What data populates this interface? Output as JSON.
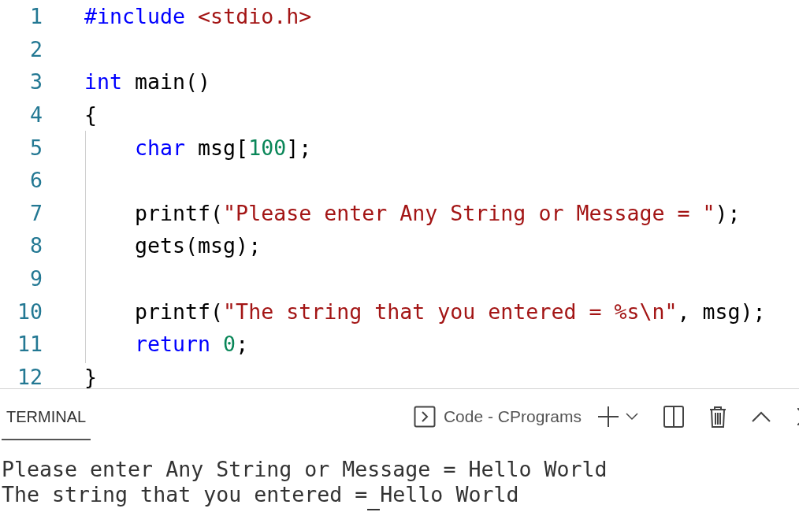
{
  "editor": {
    "lines": [
      {
        "number": "1",
        "indented": false,
        "tokens": [
          {
            "kind": "keyword",
            "text": "#include"
          },
          {
            "kind": "string",
            "text": " <stdio.h>"
          }
        ]
      },
      {
        "number": "2"
      },
      {
        "number": "3",
        "indented": false,
        "tokens": [
          {
            "kind": "keyword",
            "text": "int"
          },
          {
            "kind": "plain",
            "text": " main()"
          }
        ]
      },
      {
        "number": "4",
        "indented": false,
        "tokens": [
          {
            "kind": "plain",
            "text": "{"
          }
        ]
      },
      {
        "number": "5",
        "indented": true,
        "tokens": [
          {
            "kind": "keyword",
            "text": "char"
          },
          {
            "kind": "plain",
            "text": " msg["
          },
          {
            "kind": "number",
            "text": "100"
          },
          {
            "kind": "plain",
            "text": "];"
          }
        ]
      },
      {
        "number": "6"
      },
      {
        "number": "7",
        "indented": true,
        "tokens": [
          {
            "kind": "plain",
            "text": "printf("
          },
          {
            "kind": "string",
            "text": "\"Please enter Any String or Message = \""
          },
          {
            "kind": "plain",
            "text": ");"
          }
        ]
      },
      {
        "number": "8",
        "indented": true,
        "tokens": [
          {
            "kind": "plain",
            "text": "gets(msg);"
          }
        ]
      },
      {
        "number": "9"
      },
      {
        "number": "10",
        "indented": true,
        "tokens": [
          {
            "kind": "plain",
            "text": "printf("
          },
          {
            "kind": "string",
            "text": "\"The string that you entered = %s\\n\""
          },
          {
            "kind": "plain",
            "text": ", msg);"
          }
        ]
      },
      {
        "number": "11",
        "indented": true,
        "tokens": [
          {
            "kind": "keyword",
            "text": "return"
          },
          {
            "kind": "number",
            "text": " 0"
          },
          {
            "kind": "plain",
            "text": ";"
          }
        ]
      },
      {
        "number": "12",
        "indented": false,
        "tokens": [
          {
            "kind": "plain",
            "text": "}"
          }
        ]
      }
    ]
  },
  "panel": {
    "tabs": [
      {
        "label": "TERMINAL",
        "selected": true
      }
    ],
    "terminal_name": "Code - CPrograms",
    "output": [
      "Please enter Any String or Message = Hello World",
      "The string that you entered = Hello World"
    ]
  }
}
